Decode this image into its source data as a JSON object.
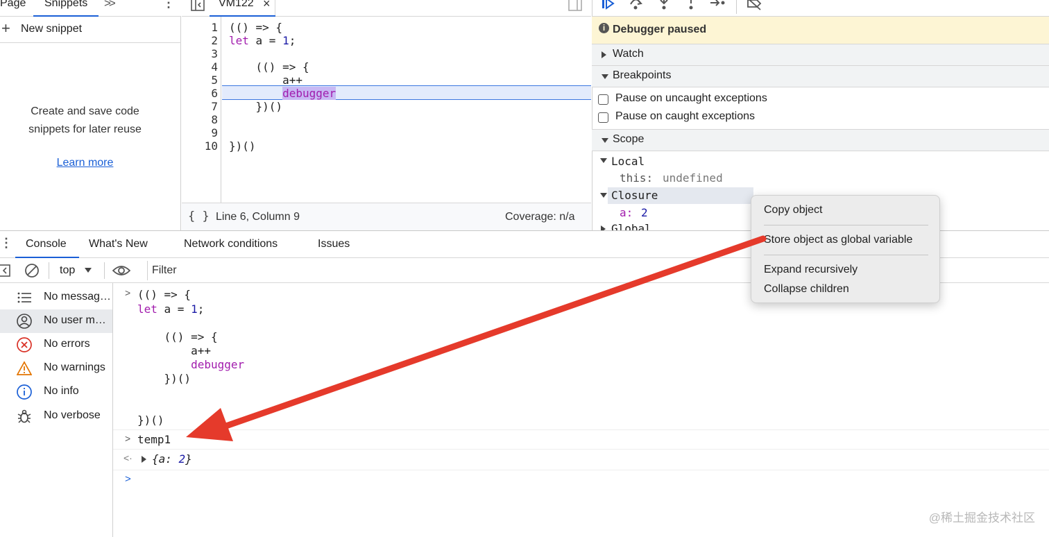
{
  "left_panel": {
    "tabs": [
      "Page",
      "Snippets"
    ],
    "more_tabs_icon": "chevron-double-right",
    "new_snippet": "New snippet",
    "empty_text_line1": "Create and save code",
    "empty_text_line2": "snippets for later reuse",
    "learn_more": "Learn more"
  },
  "editor": {
    "tab_label": "VM122",
    "line_numbers": [
      "1",
      "2",
      "3",
      "4",
      "5",
      "6",
      "7",
      "8",
      "9",
      "10"
    ],
    "lines": {
      "l1": "(() => {",
      "l2_kw": "let",
      "l2_rest": " a = ",
      "l2_num": "1",
      "l2_end": ";",
      "l4": "    (() => {",
      "l5": "        a++",
      "l6_indent": "        ",
      "l6_kw": "debugger",
      "l7": "    })()",
      "l10": "})()"
    },
    "status_braces": "{ }",
    "status_position": "Line 6, Column 9",
    "status_coverage": "Coverage: n/a"
  },
  "debugger": {
    "paused_text": "Debugger paused",
    "sections": {
      "watch": "Watch",
      "breakpoints": "Breakpoints",
      "scope": "Scope"
    },
    "pause_uncaught": "Pause on uncaught exceptions",
    "pause_caught": "Pause on caught exceptions",
    "scope": {
      "local": "Local",
      "this_key": "this:",
      "this_val": "undefined",
      "closure": "Closure",
      "a_key": "a:",
      "a_val": "2",
      "global": "Global"
    }
  },
  "context_menu": {
    "items": [
      "Copy object",
      "Store object as global variable",
      "Expand recursively",
      "Collapse children"
    ]
  },
  "drawer": {
    "tabs": [
      "Console",
      "What's New",
      "Network conditions",
      "Issues"
    ],
    "context": "top",
    "filter_placeholder": "Filter"
  },
  "console_sidebar": {
    "items": [
      {
        "label": "No messages",
        "icon": "list-icon"
      },
      {
        "label": "No user messages",
        "icon": "user-icon"
      },
      {
        "label": "No errors",
        "icon": "error-icon"
      },
      {
        "label": "No warnings",
        "icon": "warning-icon"
      },
      {
        "label": "No info",
        "icon": "info-icon"
      },
      {
        "label": "No verbose",
        "icon": "bug-icon"
      }
    ]
  },
  "console": {
    "input_block": {
      "l1": "(() => {",
      "l2_kw": "let",
      "l2_rest": " a = ",
      "l2_num": "1",
      "l2_end": ";",
      "l4": "    (() => {",
      "l5": "        a++",
      "l6_indent": "        ",
      "l6_kw": "debugger",
      "l7": "    })()",
      "l10": "})()"
    },
    "command2": "temp1",
    "result_open": "{a: ",
    "result_val": "2",
    "result_close": "}"
  },
  "colors": {
    "accent": "#1a5fd6",
    "keyword": "#a11cad",
    "number": "#1a1aa6",
    "annotation_arrow": "#e53a2b",
    "paused_bg": "#fdf5d4"
  },
  "watermark": "@稀土掘金技术社区"
}
